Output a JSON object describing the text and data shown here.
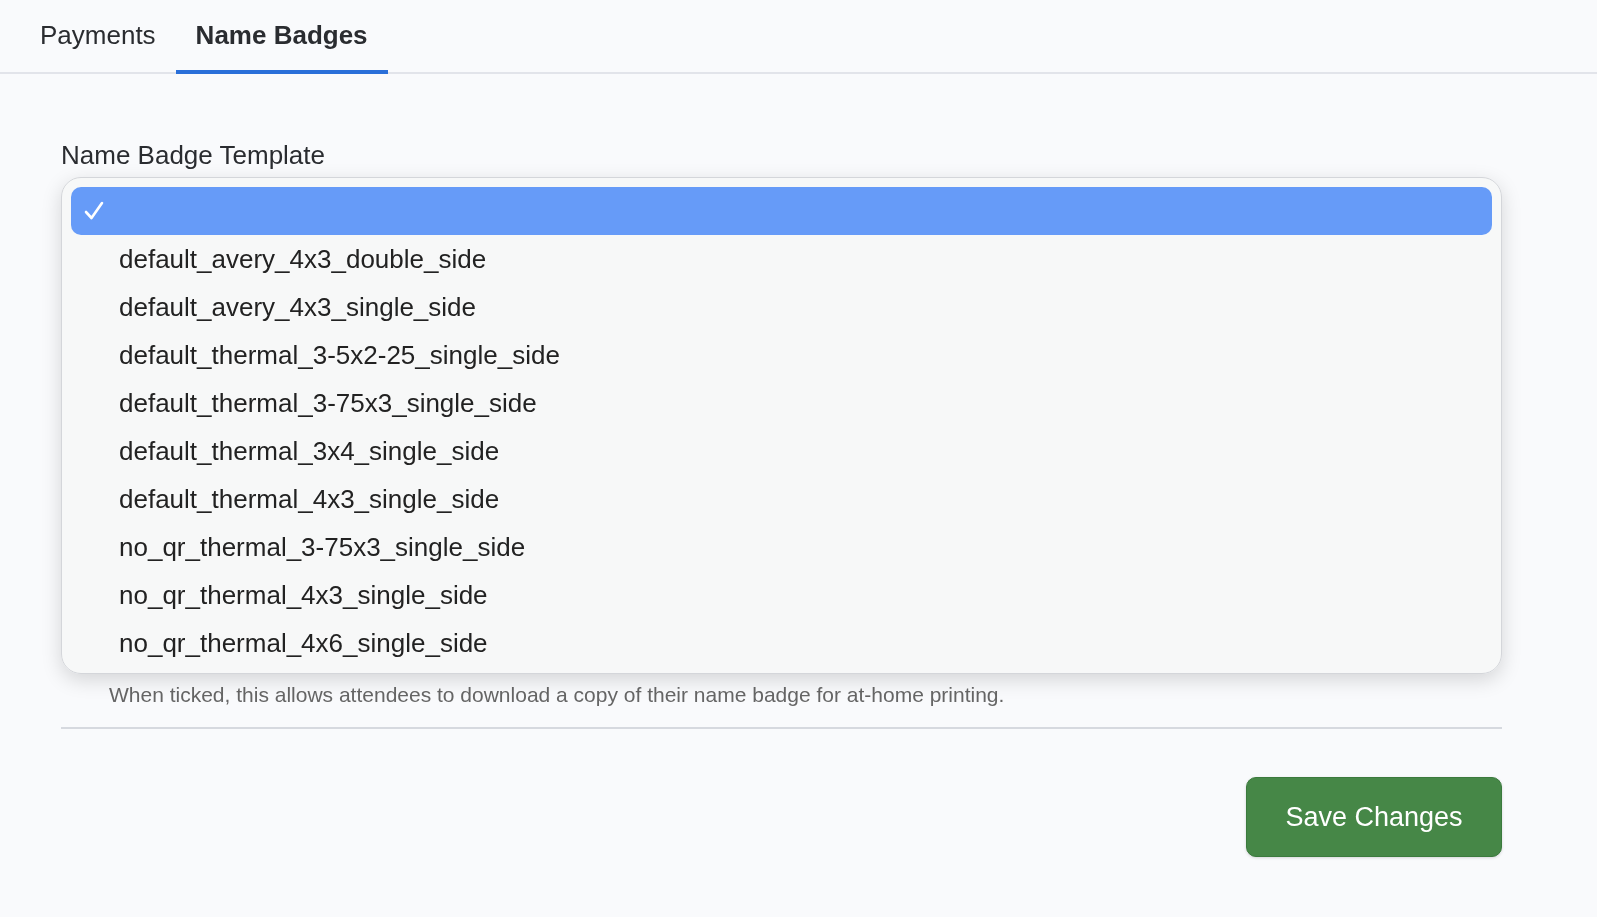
{
  "tabs": [
    {
      "label": "Payments",
      "selected": false
    },
    {
      "label": "Name Badges",
      "selected": true
    }
  ],
  "template_field": {
    "label": "Name Badge Template",
    "options": [
      {
        "selected": true
      },
      {
        "label": "default_avery_4x3_double_side",
        "selected": false
      },
      {
        "label": "default_avery_4x3_single_side",
        "selected": false
      },
      {
        "label": "default_thermal_3-5x2-25_single_side",
        "selected": false
      },
      {
        "label": "default_thermal_3-75x3_single_side",
        "selected": false
      },
      {
        "label": "default_thermal_3x4_single_side",
        "selected": false
      },
      {
        "label": "default_thermal_4x3_single_side",
        "selected": false
      },
      {
        "label": "no_qr_thermal_3-75x3_single_side",
        "selected": false
      },
      {
        "label": "no_qr_thermal_4x3_single_side",
        "selected": false
      },
      {
        "label": "no_qr_thermal_4x6_single_side",
        "selected": false
      }
    ]
  },
  "hint": "When ticked, this allows attendees to download a copy of their name badge for at-home printing.",
  "buttons": [
    "Save Changes"
  ]
}
